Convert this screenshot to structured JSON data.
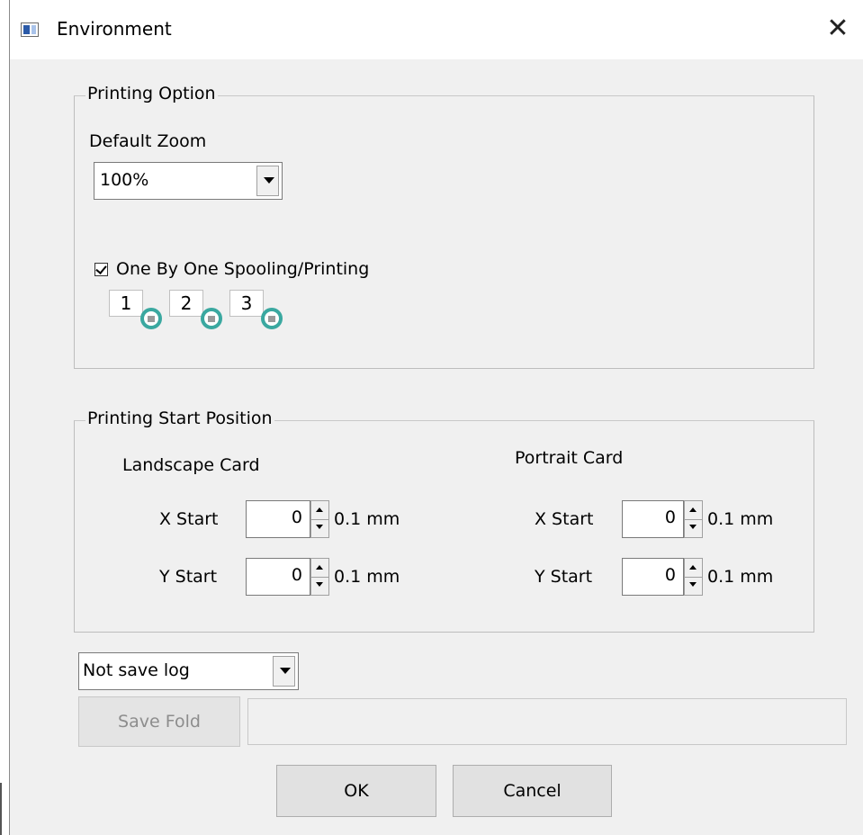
{
  "window": {
    "title": "Environment",
    "close_glyph": "✕"
  },
  "printing_option": {
    "legend": "Printing Option",
    "default_zoom_label": "Default Zoom",
    "zoom_value": "100%",
    "one_by_one_label": "One By One Spooling/Printing",
    "one_by_one_checked": true,
    "pages": [
      "1",
      "2",
      "3"
    ]
  },
  "start_position": {
    "legend": "Printing Start Position",
    "landscape": {
      "title": "Landscape Card",
      "x_label": "X Start",
      "x_value": "0",
      "y_label": "Y Start",
      "y_value": "0",
      "unit": "0.1 mm"
    },
    "portrait": {
      "title": "Portrait Card",
      "x_label": "X Start",
      "x_value": "0",
      "y_label": "Y Start",
      "y_value": "0",
      "unit": "0.1 mm"
    }
  },
  "log": {
    "value": "Not save log",
    "save_fold_label": "Save Fold",
    "path_value": ""
  },
  "buttons": {
    "ok": "OK",
    "cancel": "Cancel"
  },
  "colors": {
    "printer_accent": "#3aa8a0"
  }
}
